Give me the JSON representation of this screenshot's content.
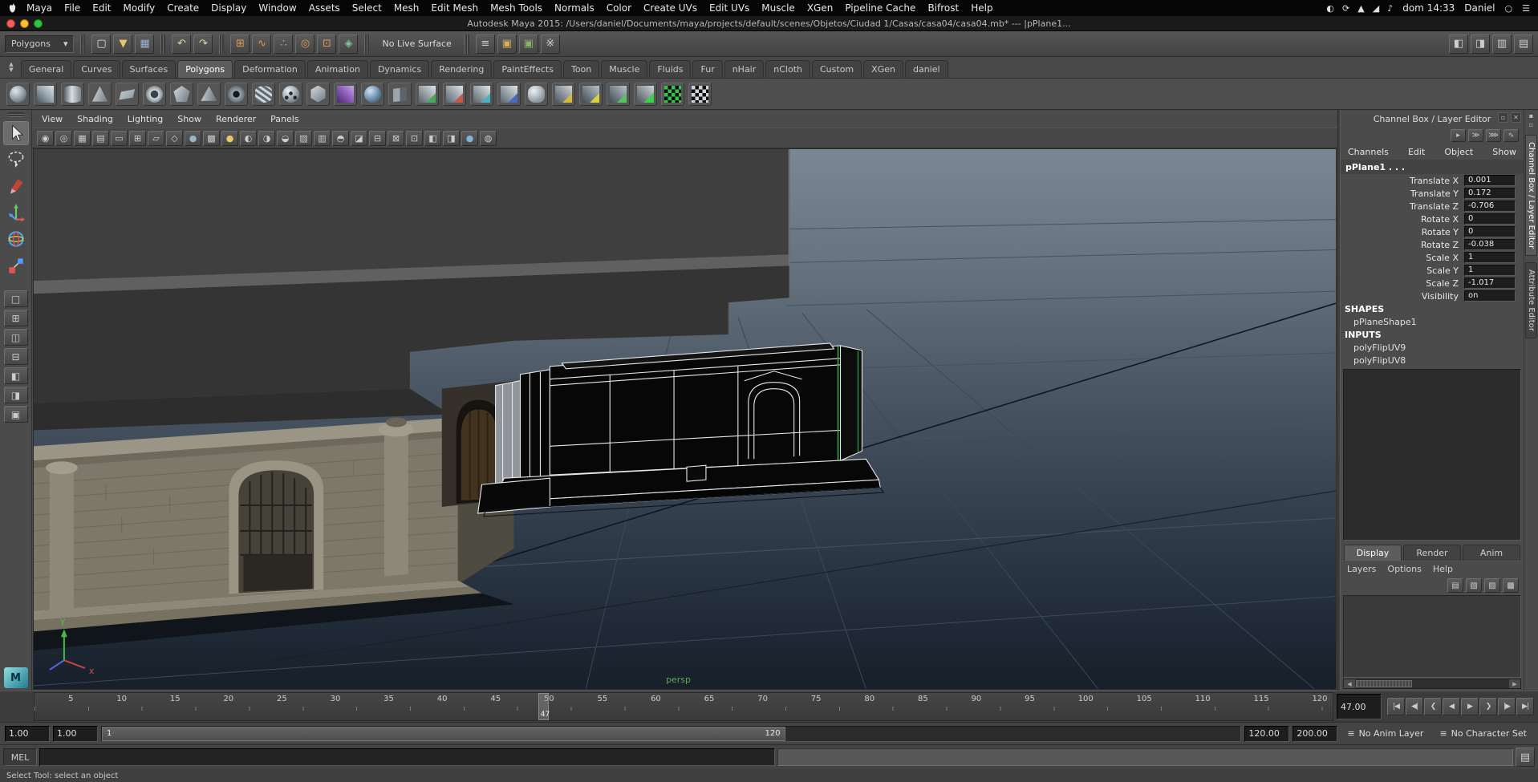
{
  "macos_menubar": {
    "menus": [
      "Maya",
      "File",
      "Edit",
      "Modify",
      "Create",
      "Display",
      "Window",
      "Assets",
      "Select",
      "Mesh",
      "Edit Mesh",
      "Mesh Tools",
      "Normals",
      "Color",
      "Create UVs",
      "Edit UVs",
      "Muscle",
      "XGen",
      "Pipeline Cache",
      "Bifrost",
      "Help"
    ],
    "status_icons": [
      {
        "name": "notification-icon",
        "glyph": "◐"
      },
      {
        "name": "time-machine-icon",
        "glyph": "⟳"
      },
      {
        "name": "bluetooth-icon",
        "glyph": "▲"
      },
      {
        "name": "wifi-icon",
        "glyph": "◢"
      },
      {
        "name": "volume-icon",
        "glyph": "♪"
      }
    ],
    "clock": "dom 14:33",
    "user": "Daniel",
    "search_glyph": "○",
    "list_glyph": "☰"
  },
  "titlebar": {
    "title": "Autodesk Maya 2015: /Users/daniel/Documents/maya/projects/default/scenes/Objetos/Ciudad 1/Casas/casa04/casa04.mb*   ---   |pPlane1..."
  },
  "statusline": {
    "selection_mode": "Polygons",
    "dropdown_arrow": "▾",
    "file_icons": [
      {
        "name": "new-scene-icon",
        "glyph": "▢",
        "style": "color:#e0e0e0"
      },
      {
        "name": "open-scene-icon",
        "glyph": "▼",
        "style": "color:#e8c76a"
      },
      {
        "name": "save-scene-icon",
        "glyph": "▦",
        "style": "color:#9ab0d8"
      }
    ],
    "history_icons": [
      {
        "name": "undo-icon",
        "glyph": "↶",
        "style": "color:#cfe08a"
      },
      {
        "name": "redo-icon",
        "glyph": "↷",
        "style": "color:#cfe08a"
      }
    ],
    "snap_icons": [
      {
        "name": "snap-to-grid-icon",
        "glyph": "⊞",
        "style": "color:#e09a5a"
      },
      {
        "name": "snap-to-curve-icon",
        "glyph": "∿",
        "style": "color:#e09a5a"
      },
      {
        "name": "snap-to-point-icon",
        "glyph": "∴",
        "style": "color:#e09a5a"
      },
      {
        "name": "snap-to-projected-center-icon",
        "glyph": "◎",
        "style": "color:#e09a5a"
      },
      {
        "name": "snap-to-view-plane-icon",
        "glyph": "⊡",
        "style": "color:#e09a5a"
      },
      {
        "name": "make-live-icon",
        "glyph": "◈",
        "style": "color:#7ec8a0"
      }
    ],
    "live_surface_label": "No Live Surface",
    "render_icons": [
      {
        "name": "construction-history-icon",
        "glyph": "≡",
        "style": "color:#cccccc"
      },
      {
        "name": "render-current-frame-icon",
        "glyph": "▣",
        "style": "color:#d8b25a"
      },
      {
        "name": "ipr-render-icon",
        "glyph": "▣",
        "style": "color:#8ab06a"
      },
      {
        "name": "render-settings-icon",
        "glyph": "※",
        "style": "color:#cccccc"
      }
    ],
    "sidebar_toggle_icons": [
      {
        "name": "toggle-modeling-toolkit-icon",
        "glyph": "◧"
      },
      {
        "name": "toggle-attribute-editor-icon",
        "glyph": "◨"
      },
      {
        "name": "toggle-tool-settings-icon",
        "glyph": "▥"
      },
      {
        "name": "toggle-channel-box-icon",
        "glyph": "▤"
      }
    ]
  },
  "shelf": {
    "tabs": [
      {
        "label": "General",
        "cls": "tab"
      },
      {
        "label": "Curves",
        "cls": "tab"
      },
      {
        "label": "Surfaces",
        "cls": "tab"
      },
      {
        "label": "Polygons",
        "cls": "tab active"
      },
      {
        "label": "Deformation",
        "cls": "tab"
      },
      {
        "label": "Animation",
        "cls": "tab"
      },
      {
        "label": "Dynamics",
        "cls": "tab"
      },
      {
        "label": "Rendering",
        "cls": "tab"
      },
      {
        "label": "PaintEffects",
        "cls": "tab"
      },
      {
        "label": "Toon",
        "cls": "tab"
      },
      {
        "label": "Muscle",
        "cls": "tab"
      },
      {
        "label": "Fluids",
        "cls": "tab"
      },
      {
        "label": "Fur",
        "cls": "tab"
      },
      {
        "label": "nHair",
        "cls": "tab"
      },
      {
        "label": "nCloth",
        "cls": "tab"
      },
      {
        "label": "Custom",
        "cls": "tab"
      },
      {
        "label": "XGen",
        "cls": "tab"
      },
      {
        "label": "daniel",
        "cls": "tab"
      }
    ],
    "icons": [
      {
        "name": "poly-sphere-icon",
        "style": "border-radius:50%;background:radial-gradient(circle at 35% 30%,#e2e8ec,#8a97a1 55%,#3f4a52)"
      },
      {
        "name": "poly-cube-icon",
        "style": "background:linear-gradient(225deg,#dfe5e9,#97a3ad 50%,#4a545c)"
      },
      {
        "name": "poly-cylinder-icon",
        "style": "border-radius:45%/18%;background:linear-gradient(90deg,#5a646c,#d8dee2 45%,#7b868f)"
      },
      {
        "name": "poly-cone-icon",
        "style": "clip-path:polygon(50% 4%,96% 96%,4% 96%);background:linear-gradient(110deg,#d8dee2,#6a757e)"
      },
      {
        "name": "poly-plane-icon",
        "style": "clip-path:polygon(14% 38%,96% 22%,84% 72%,2% 86%);background:linear-gradient(135deg,#cfd6db,#828e97)"
      },
      {
        "name": "poly-torus-icon",
        "style": "border-radius:50%;background:radial-gradient(circle,#38424a 30%,#d4dade 34%,#76828b 75%,#3f4a52)"
      },
      {
        "name": "poly-prism-icon",
        "style": "clip-path:polygon(50% 2%,98% 36%,80% 98%,20% 98%,2% 36%);background:linear-gradient(120deg,#d4dade,#6a757e)"
      },
      {
        "name": "poly-pyramid-icon",
        "style": "clip-path:polygon(50% 4%,98% 92%,2% 92%);background:linear-gradient(100deg,#cfd6db,#5f6a72)"
      },
      {
        "name": "poly-pipe-icon",
        "style": "border-radius:50%;background:radial-gradient(circle,#14181b 26%,#9aa5ae 30%,#5a646c 78%)"
      },
      {
        "name": "poly-helix-icon",
        "style": "border-radius:50%/30%;background:repeating-linear-gradient(35deg,#cfd6db 0 3px,#5f6a72 3px 6px)"
      },
      {
        "name": "poly-soccerball-icon",
        "style": "border-radius:50%;background:radial-gradient(circle at 50% 45%,#23282c 14%,transparent 15%),radial-gradient(circle at 25% 70%,#23282c 10%,transparent 11%),radial-gradient(circle at 75% 70%,#23282c 10%,transparent 11%),radial-gradient(circle at 35% 30%,#eef2f4,#8a97a1 60%,#4a545c)"
      },
      {
        "name": "platonic-solid-icon",
        "style": "clip-path:polygon(50% 0,93% 25%,93% 75%,50% 100%,7% 75%,7% 25%);background:linear-gradient(140deg,#d8dee2,#6a757e)"
      },
      {
        "name": "sculpt-cube-icon",
        "style": "background:linear-gradient(225deg,#c9a6e8,#8a5ab8 50%,#4a2a6a)"
      },
      {
        "name": "smooth-sphere-icon",
        "style": "border-radius:50%;background:radial-gradient(circle at 35% 30%,#cfe2f2,#6a8aaa 55%,#2f4456)"
      },
      {
        "name": "mirror-plane-icon",
        "style": "clip-path:polygon(10% 20%,90% 10%,90% 90%,10% 98%);background:linear-gradient(90deg,#9aa5ae 49%,#5a646c 51%)"
      },
      {
        "name": "combine-icon",
        "style": "background:linear-gradient(315deg,#4aa85a 0 28%,transparent 28%),linear-gradient(225deg,#dfe5e9,#59646c)"
      },
      {
        "name": "separate-icon",
        "style": "background:linear-gradient(315deg,#c25a4a 0 28%,transparent 28%),linear-gradient(225deg,#dfe5e9,#59646c)"
      },
      {
        "name": "extract-icon",
        "style": "background:linear-gradient(315deg,#4ab2c2 0 28%,transparent 28%),linear-gradient(225deg,#dfe5e9,#59646c)"
      },
      {
        "name": "boolean-icon",
        "style": "background:linear-gradient(315deg,#4a6ac2 0 28%,transparent 28%),linear-gradient(225deg,#dfe5e9,#59646c)"
      },
      {
        "name": "smooth-icon",
        "style": "border-radius:40%;background:radial-gradient(circle at 35% 30%,#eef2f4,#8a97a1 70%)"
      },
      {
        "name": "extrude-icon",
        "style": "background:linear-gradient(315deg,#d8b83a 0 28%,transparent 28%),linear-gradient(225deg,#cfd6db,#4a545c)"
      },
      {
        "name": "bevel-icon",
        "style": "background:linear-gradient(315deg,#d8d23a 0 28%,transparent 28%),linear-gradient(225deg,#b8c2ca,#3f4a52)"
      },
      {
        "name": "bridge-icon",
        "style": "background:linear-gradient(315deg,#5ac25a 0 28%,transparent 28%),linear-gradient(225deg,#b8c2ca,#3f4a52)"
      },
      {
        "name": "multi-cut-icon",
        "style": "background:linear-gradient(315deg,#3ad24a 0 30%,transparent 30%),linear-gradient(225deg,#cfd6db,#4a545c)"
      },
      {
        "name": "checker-green-icon",
        "style": "background:repeating-conic-gradient(#101010 0% 25%,#35c24a 0% 50%) 0 0/9px 9px"
      },
      {
        "name": "checker-gray-icon",
        "style": "background:repeating-conic-gradient(#101010 0% 25%,#cfd6db 0% 50%) 0 0/9px 9px"
      }
    ]
  },
  "toolbox": {
    "tools": [
      "select-tool",
      "lasso-tool",
      "paint-selection-tool",
      "move-tool",
      "rotate-tool",
      "scale-tool"
    ],
    "layouts": [
      {
        "name": "single-pane-layout-button",
        "glyph": "□"
      },
      {
        "name": "four-pane-layout-button",
        "glyph": "⊞"
      },
      {
        "name": "two-side-by-side-layout-button",
        "glyph": "◫"
      },
      {
        "name": "two-stacked-layout-button",
        "glyph": "⊟"
      },
      {
        "name": "persp-outliner-layout-button",
        "glyph": "◧"
      },
      {
        "name": "persp-graph-layout-button",
        "glyph": "◨"
      },
      {
        "name": "hypershade-layout-button",
        "glyph": "▣"
      }
    ]
  },
  "panel_menus": {
    "items": [
      "View",
      "Shading",
      "Lighting",
      "Show",
      "Renderer",
      "Panels"
    ]
  },
  "panel_toolbar": {
    "icons": [
      {
        "name": "select-camera-icon",
        "glyph": "◉"
      },
      {
        "name": "lock-camera-icon",
        "glyph": "◎"
      },
      {
        "name": "camera-attributes-icon",
        "glyph": "▦"
      },
      {
        "name": "bookmarks-icon",
        "glyph": "▤"
      },
      {
        "name": "image-plane-icon",
        "glyph": "▭"
      },
      {
        "name": "two-d-pan-zoom-icon",
        "glyph": "⊞"
      },
      {
        "name": "grease-pencil-icon",
        "glyph": "▱"
      },
      {
        "name": "wireframe-icon",
        "glyph": "◇"
      },
      {
        "name": "shaded-icon",
        "glyph": "●",
        "style": "color:#9ab4c4"
      },
      {
        "name": "textured-icon",
        "glyph": "▩"
      },
      {
        "name": "use-all-lights-icon",
        "glyph": "●",
        "style": "color:#e8c96a"
      },
      {
        "name": "shadows-icon",
        "glyph": "◐"
      },
      {
        "name": "screen-space-ao-icon",
        "glyph": "◑"
      },
      {
        "name": "motion-blur-icon",
        "glyph": "◒"
      },
      {
        "name": "multisample-icon",
        "glyph": "▨"
      },
      {
        "name": "sequence-time-icon",
        "glyph": "▥"
      },
      {
        "name": "exposure-icon",
        "glyph": "◓"
      },
      {
        "name": "gamma-icon",
        "glyph": "◪"
      },
      {
        "name": "gate-mask-icon",
        "glyph": "⊟"
      },
      {
        "name": "film-gate-icon",
        "glyph": "⊠"
      },
      {
        "name": "resolution-gate-icon",
        "glyph": "⊡"
      },
      {
        "name": "isolate-select-icon",
        "glyph": "◧"
      },
      {
        "name": "xray-icon",
        "glyph": "◨"
      },
      {
        "name": "default-material-icon",
        "glyph": "●",
        "style": "color:#7fb3d5"
      },
      {
        "name": "wireframe-on-shaded-icon",
        "glyph": "◍"
      }
    ]
  },
  "viewport": {
    "camera_label": "persp",
    "axis": {
      "y": "Y",
      "x": "x"
    }
  },
  "channel_box": {
    "header": "Channel Box / Layer Editor",
    "window_icons": [
      {
        "name": "float-panel-icon",
        "glyph": "▫"
      },
      {
        "name": "close-panel-icon",
        "glyph": "✕"
      }
    ],
    "speed_icons": [
      {
        "name": "slow-channel-drag-icon",
        "glyph": "▸"
      },
      {
        "name": "medium-channel-drag-icon",
        "glyph": "≫"
      },
      {
        "name": "fast-channel-drag-icon",
        "glyph": "⋙"
      },
      {
        "name": "hyperbolic-curve-icon",
        "glyph": "∿"
      }
    ],
    "menus": [
      "Channels",
      "Edit",
      "Object",
      "Show"
    ],
    "object_name": "pPlane1 . . .",
    "attributes": [
      {
        "label": "Translate X",
        "value": "0.001"
      },
      {
        "label": "Translate Y",
        "value": "0.172"
      },
      {
        "label": "Translate Z",
        "value": "-0.706"
      },
      {
        "label": "Rotate X",
        "value": "0"
      },
      {
        "label": "Rotate Y",
        "value": "0"
      },
      {
        "label": "Rotate Z",
        "value": "-0.038"
      },
      {
        "label": "Scale X",
        "value": "1"
      },
      {
        "label": "Scale Y",
        "value": "1"
      },
      {
        "label": "Scale Z",
        "value": "-1.017"
      },
      {
        "label": "Visibility",
        "value": "on"
      }
    ],
    "shapes_header": "SHAPES",
    "shape_name": "pPlaneShape1",
    "inputs_header": "INPUTS",
    "inputs": [
      "polyFlipUV9",
      "polyFlipUV8"
    ]
  },
  "layer_editor": {
    "tabs": [
      {
        "label": "Display",
        "cls": "letab active"
      },
      {
        "label": "Render",
        "cls": "letab"
      },
      {
        "label": "Anim",
        "cls": "letab"
      }
    ],
    "menus": [
      "Layers",
      "Options",
      "Help"
    ],
    "icons": [
      {
        "name": "toggle-layer-visibility-icon",
        "glyph": "▤"
      },
      {
        "name": "new-empty-layer-icon",
        "glyph": "▧"
      },
      {
        "name": "new-layer-from-selected-icon",
        "glyph": "▨"
      },
      {
        "name": "layer-attributes-icon",
        "glyph": "▩"
      }
    ]
  },
  "right_strip": {
    "icons": [
      {
        "name": "dock-icon",
        "glyph": "▪"
      },
      {
        "name": "undock-icon",
        "glyph": "▫"
      }
    ],
    "tabs": [
      {
        "label": "Channel Box / Layer Editor",
        "cls": "vtab active"
      },
      {
        "label": "Attribute Editor",
        "cls": "vtab"
      }
    ]
  },
  "time_slider": {
    "tick_labels": [
      "5",
      "10",
      "15",
      "20",
      "25",
      "30",
      "35",
      "40",
      "45",
      "50",
      "55",
      "60",
      "65",
      "70",
      "75",
      "80",
      "85",
      "90",
      "95",
      "100",
      "105",
      "110",
      "115",
      "120"
    ],
    "current_frame": "47",
    "current_time": "47.00",
    "playback_buttons": [
      {
        "name": "go-to-start-button",
        "glyph": "|◀"
      },
      {
        "name": "step-back-frame-button",
        "glyph": "◀|"
      },
      {
        "name": "step-back-key-button",
        "glyph": "❮"
      },
      {
        "name": "play-backwards-button",
        "glyph": "◀"
      },
      {
        "name": "play-forwards-button",
        "glyph": "▶"
      },
      {
        "name": "step-forward-key-button",
        "glyph": "❯"
      },
      {
        "name": "step-forward-frame-button",
        "glyph": "|▶"
      },
      {
        "name": "go-to-end-button",
        "glyph": "▶|"
      }
    ]
  },
  "range_slider": {
    "animation_start": "1.00",
    "playback_start": "1.00",
    "bar_start_label": "1",
    "bar_end_label": "120",
    "playback_end": "120.00",
    "animation_end": "200.00",
    "anim_layer_icon": "≡",
    "anim_layer_label": "No Anim Layer",
    "character_set_icon": "≡",
    "character_set_label": "No Character Set"
  },
  "command_line": {
    "label": "MEL",
    "input_value": "",
    "script_editor_icon": "▤"
  },
  "help_line": {
    "text": "Select Tool: select an object"
  }
}
